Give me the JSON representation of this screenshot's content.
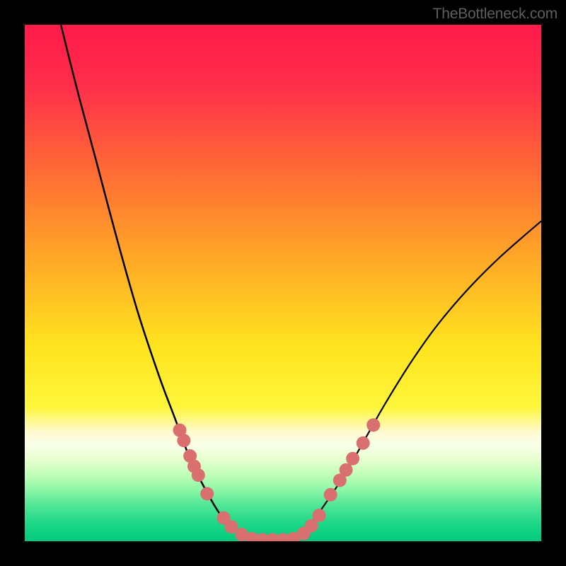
{
  "watermark": "TheBottleneck.com",
  "chart_data": {
    "type": "line",
    "title": "",
    "xlabel": "",
    "ylabel": "",
    "xlim": [
      0,
      100
    ],
    "ylim": [
      0,
      100
    ],
    "gradient_stops": [
      {
        "pos": 0.0,
        "color": "#ff1a4a"
      },
      {
        "pos": 0.12,
        "color": "#ff2f4a"
      },
      {
        "pos": 0.28,
        "color": "#ff6a35"
      },
      {
        "pos": 0.45,
        "color": "#ffa727"
      },
      {
        "pos": 0.62,
        "color": "#ffe31f"
      },
      {
        "pos": 0.74,
        "color": "#fef63a"
      },
      {
        "pos": 0.79,
        "color": "#fffad4"
      },
      {
        "pos": 0.815,
        "color": "#f8ffe8"
      },
      {
        "pos": 0.84,
        "color": "#e8ffd0"
      },
      {
        "pos": 0.87,
        "color": "#c2ffb8"
      },
      {
        "pos": 0.9,
        "color": "#8cf7a7"
      },
      {
        "pos": 0.93,
        "color": "#50e696"
      },
      {
        "pos": 0.965,
        "color": "#1fd888"
      },
      {
        "pos": 1.0,
        "color": "#00c97d"
      }
    ],
    "series": [
      {
        "name": "left-curve",
        "points": [
          {
            "x": 7,
            "y": 100
          },
          {
            "x": 10,
            "y": 88
          },
          {
            "x": 14,
            "y": 73
          },
          {
            "x": 18,
            "y": 58
          },
          {
            "x": 22,
            "y": 44
          },
          {
            "x": 26,
            "y": 32
          },
          {
            "x": 29,
            "y": 24
          },
          {
            "x": 32,
            "y": 16
          },
          {
            "x": 35,
            "y": 10
          },
          {
            "x": 38,
            "y": 5
          },
          {
            "x": 41,
            "y": 2
          },
          {
            "x": 44,
            "y": 0.5
          }
        ]
      },
      {
        "name": "right-curve",
        "points": [
          {
            "x": 52,
            "y": 0.5
          },
          {
            "x": 55,
            "y": 3
          },
          {
            "x": 58,
            "y": 7
          },
          {
            "x": 62,
            "y": 13
          },
          {
            "x": 66,
            "y": 20
          },
          {
            "x": 70,
            "y": 27
          },
          {
            "x": 75,
            "y": 35
          },
          {
            "x": 80,
            "y": 42
          },
          {
            "x": 86,
            "y": 49
          },
          {
            "x": 92,
            "y": 55
          },
          {
            "x": 100,
            "y": 62
          }
        ]
      }
    ],
    "marker_clusters": [
      {
        "name": "left-upper-markers",
        "points": [
          {
            "x": 30.0,
            "y": 21.5
          },
          {
            "x": 30.8,
            "y": 19.5
          },
          {
            "x": 32.0,
            "y": 16.5
          },
          {
            "x": 32.8,
            "y": 14.5
          },
          {
            "x": 33.6,
            "y": 12.8
          },
          {
            "x": 35.3,
            "y": 9.2
          }
        ]
      },
      {
        "name": "right-upper-markers",
        "points": [
          {
            "x": 59.2,
            "y": 9.0
          },
          {
            "x": 61.0,
            "y": 11.8
          },
          {
            "x": 62.2,
            "y": 13.8
          },
          {
            "x": 63.5,
            "y": 16.0
          },
          {
            "x": 65.5,
            "y": 19.0
          },
          {
            "x": 67.5,
            "y": 22.5
          }
        ]
      },
      {
        "name": "bottom-markers",
        "points": [
          {
            "x": 38.5,
            "y": 4.5
          },
          {
            "x": 40.0,
            "y": 2.8
          },
          {
            "x": 42.0,
            "y": 1.3
          },
          {
            "x": 44.0,
            "y": 0.5
          },
          {
            "x": 46.0,
            "y": 0.3
          },
          {
            "x": 48.0,
            "y": 0.3
          },
          {
            "x": 50.0,
            "y": 0.3
          },
          {
            "x": 52.0,
            "y": 0.5
          },
          {
            "x": 54.0,
            "y": 1.5
          },
          {
            "x": 55.5,
            "y": 3.0
          },
          {
            "x": 57.0,
            "y": 5.0
          }
        ]
      }
    ],
    "marker_color": "#d96f6f",
    "marker_radius": 1.3
  }
}
